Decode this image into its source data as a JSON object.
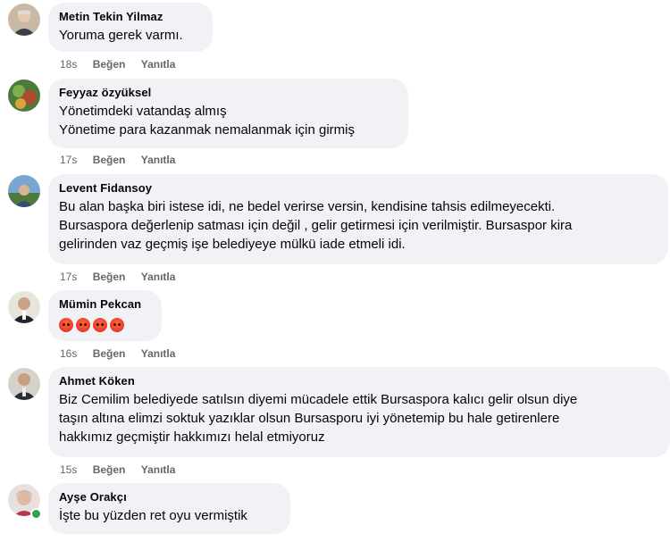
{
  "comments": [
    {
      "author": "Metin Tekin Yilmaz",
      "lines": [
        "Yoruma gerek varmı."
      ],
      "time": "18s",
      "like": "Beğen",
      "reply": "Yanıtla"
    },
    {
      "author": "Feyyaz özyüksel",
      "lines": [
        "Yönetimdeki vatandaş almış",
        "Yönetime para kazanmak nemalanmak için girmiş"
      ],
      "time": "17s",
      "like": "Beğen",
      "reply": "Yanıtla"
    },
    {
      "author": "Levent Fidansoy",
      "lines": [
        "Bu alan başka biri istese idi, ne bedel verirse versin, kendisine tahsis edilmeyecekti.",
        "Bursaspora değerlenip satması için değil , gelir getirmesi için verilmiştir. Bursaspor kira",
        "gelirinden vaz geçmiş işe belediyeye mülkü iade etmeli idi."
      ],
      "time": "17s",
      "like": "Beğen",
      "reply": "Yanıtla"
    },
    {
      "author": "Mümin Pekcan",
      "emoji_count": 4,
      "emoji_name": "angry-face-icon",
      "time": "16s",
      "like": "Beğen",
      "reply": "Yanıtla"
    },
    {
      "author": "Ahmet Köken",
      "lines": [
        "Biz Cemilim belediyede satılsın diyemi mücadele ettik Bursaspora kalıcı gelir olsun diye",
        "taşın altına elimzi soktuk yazıklar olsun Bursasporu iyi yönetemip bu hale getirenlere",
        "hakkımız geçmiştir hakkımızı helal etmiyoruz"
      ],
      "time": "15s",
      "like": "Beğen",
      "reply": "Yanıtla"
    },
    {
      "author": "Ayşe Orakçı",
      "lines": [
        "İşte bu yüzden ret oyu vermiştik"
      ],
      "online": true
    }
  ],
  "colors": {
    "bubble": "#f0f2f5",
    "text": "#050505",
    "meta": "#65676b",
    "online": "#31a24c"
  }
}
